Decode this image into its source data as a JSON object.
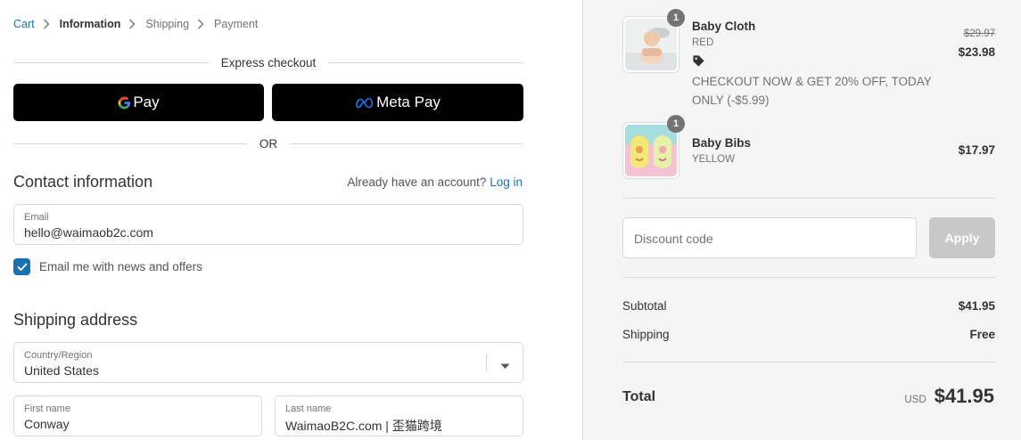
{
  "breadcrumb": {
    "cart": "Cart",
    "information": "Information",
    "shipping": "Shipping",
    "payment": "Payment"
  },
  "express": {
    "title": "Express checkout",
    "gpay_label": "Pay",
    "metapay_label": "Meta Pay",
    "or_label": "OR"
  },
  "contact": {
    "title": "Contact information",
    "account_prompt": "Already have an account?",
    "login_link": "Log in",
    "email_label": "Email",
    "email_value": "hello@waimaob2c.com",
    "news_checkbox_label": "Email me with news and offers",
    "news_checked": true
  },
  "shipping_address": {
    "title": "Shipping address",
    "country_label": "Country/Region",
    "country_value": "United States",
    "first_name_label": "First name",
    "first_name_value": "Conway",
    "last_name_label": "Last name",
    "last_name_value": "WaimaoB2C.com | 歪猫跨境"
  },
  "order": {
    "items": [
      {
        "name": "Baby Cloth",
        "variant": "RED",
        "quantity": "1",
        "price_original": "$29.97",
        "price": "$23.98",
        "discount_note": "CHECKOUT NOW & GET 20% OFF, TODAY ONLY (-$5.99)",
        "icon": "tag-icon"
      },
      {
        "name": "Baby Bibs",
        "variant": "YELLOW",
        "quantity": "1",
        "price": "$17.97"
      }
    ],
    "discount_placeholder": "Discount code",
    "apply_label": "Apply",
    "subtotal_label": "Subtotal",
    "subtotal_value": "$41.95",
    "shipping_label": "Shipping",
    "shipping_value": "Free",
    "total_label": "Total",
    "currency": "USD",
    "total_value": "$41.95"
  },
  "colors": {
    "link": "#1773b0",
    "button_dark": "#000000",
    "apply_disabled": "#c8c8c8",
    "sidebar_bg": "#f5f5f5"
  }
}
